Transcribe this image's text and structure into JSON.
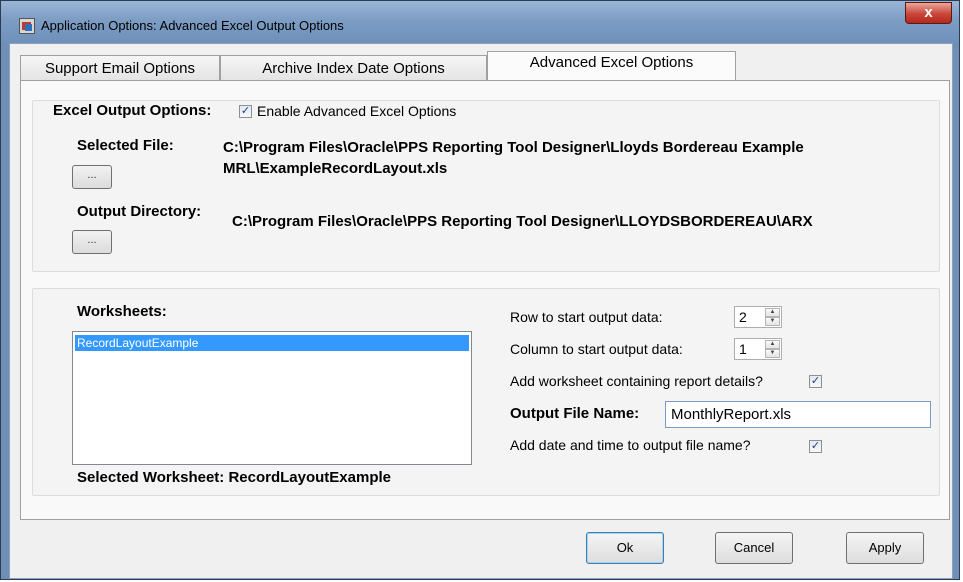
{
  "window": {
    "title": "Application Options: Advanced Excel Output Options",
    "close_label": "x"
  },
  "tabs": [
    {
      "label": "Support Email Options"
    },
    {
      "label": "Archive Index Date Options"
    },
    {
      "label": "Advanced Excel Options"
    }
  ],
  "excel_output": {
    "group_label": "Excel Output Options:",
    "enable_label": "Enable Advanced Excel Options",
    "enable_checked": true,
    "selected_file_label": "Selected File:",
    "selected_file_line1": "C:\\Program Files\\Oracle\\PPS Reporting Tool Designer\\Lloyds Bordereau Example",
    "selected_file_line2": "MRL\\ExampleRecordLayout.xls",
    "output_dir_label": "Output Directory:",
    "output_dir_value": "C:\\Program Files\\Oracle\\PPS Reporting Tool Designer\\LLOYDSBORDEREAU\\ARX",
    "browse_label": "..."
  },
  "worksheets": {
    "label": "Worksheets:",
    "items": [
      "RecordLayoutExample"
    ],
    "selected_label": "Selected Worksheet: RecordLayoutExample"
  },
  "options": {
    "row_label": "Row to start output data:",
    "row_value": "2",
    "col_label": "Column to start output data:",
    "col_value": "1",
    "add_worksheet_label": "Add worksheet containing report details?",
    "add_worksheet_checked": true,
    "output_name_label": "Output File Name:",
    "output_name_value": "MonthlyReport.xls",
    "add_datetime_label": "Add date and time to output file name?",
    "add_datetime_checked": true
  },
  "buttons": {
    "ok": "Ok",
    "cancel": "Cancel",
    "apply": "Apply"
  },
  "colors": {
    "selection": "#3399ff",
    "titlebar": "#7d9dc4",
    "close": "#c9463a"
  }
}
